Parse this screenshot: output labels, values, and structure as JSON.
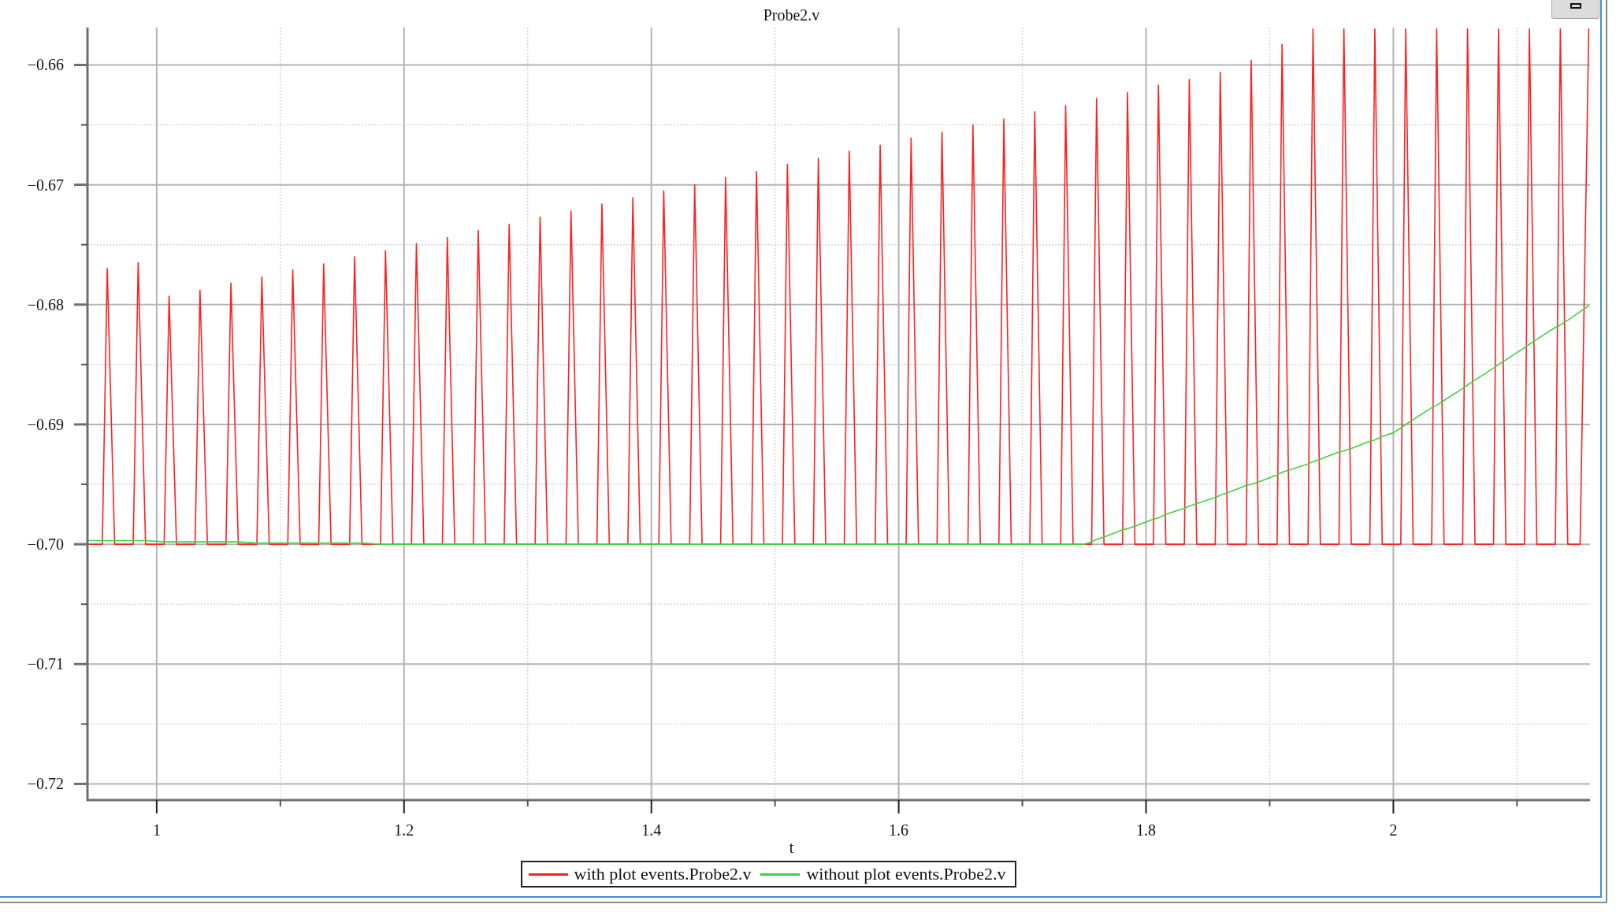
{
  "plot": {
    "chart_data": {
      "type": "line",
      "title": "Probe2.v",
      "xlabel": "t",
      "grid": true,
      "xlim": [
        0.944,
        2.159
      ],
      "ylim": [
        -0.72135,
        -0.65688
      ],
      "xticks": [
        {
          "value": 1,
          "label": "1"
        },
        {
          "value": 1.2,
          "label": "1.2"
        },
        {
          "value": 1.4,
          "label": "1.4"
        },
        {
          "value": 1.6,
          "label": "1.6"
        },
        {
          "value": 1.8,
          "label": "1.8"
        },
        {
          "value": 2,
          "label": "2"
        }
      ],
      "yticks": [
        {
          "value": -0.72,
          "label": "−0.72"
        },
        {
          "value": -0.71,
          "label": "−0.71"
        },
        {
          "value": -0.7,
          "label": "−0.70"
        },
        {
          "value": -0.69,
          "label": "−0.69"
        },
        {
          "value": -0.68,
          "label": "−0.68"
        },
        {
          "value": -0.67,
          "label": "−0.67"
        },
        {
          "value": -0.66,
          "label": "−0.66"
        }
      ],
      "x": [
        0.945,
        0.956,
        0.96,
        0.966,
        0.981,
        0.985,
        0.991,
        1.006,
        1.01,
        1.016,
        1.031,
        1.035,
        1.041,
        1.056,
        1.06,
        1.066,
        1.081,
        1.085,
        1.091,
        1.106,
        1.11,
        1.116,
        1.131,
        1.135,
        1.141,
        1.156,
        1.16,
        1.166,
        1.181,
        1.185,
        1.191,
        1.206,
        1.21,
        1.216,
        1.231,
        1.235,
        1.241,
        1.256,
        1.26,
        1.266,
        1.281,
        1.285,
        1.291,
        1.306,
        1.31,
        1.316,
        1.331,
        1.335,
        1.341,
        1.356,
        1.36,
        1.366,
        1.381,
        1.385,
        1.391,
        1.406,
        1.41,
        1.416,
        1.431,
        1.435,
        1.441,
        1.456,
        1.46,
        1.466,
        1.481,
        1.485,
        1.491,
        1.506,
        1.51,
        1.516,
        1.531,
        1.535,
        1.541,
        1.556,
        1.56,
        1.566,
        1.581,
        1.585,
        1.591,
        1.606,
        1.61,
        1.616,
        1.631,
        1.635,
        1.641,
        1.656,
        1.66,
        1.666,
        1.681,
        1.685,
        1.691,
        1.706,
        1.71,
        1.716,
        1.731,
        1.735,
        1.741,
        1.75,
        1.756,
        1.76,
        1.766,
        1.781,
        1.785,
        1.791,
        1.806,
        1.81,
        1.816,
        1.831,
        1.835,
        1.841,
        1.856,
        1.86,
        1.866,
        1.881,
        1.885,
        1.891,
        1.906,
        1.91,
        1.916,
        1.931,
        1.935,
        1.941,
        1.956,
        1.96,
        1.966,
        1.981,
        1.985,
        1.991,
        2.0,
        2.006,
        2.01,
        2.016,
        2.031,
        2.035,
        2.041,
        2.056,
        2.06,
        2.066,
        2.081,
        2.085,
        2.091,
        2.106,
        2.11,
        2.116,
        2.131,
        2.135,
        2.141,
        2.151,
        2.158
      ],
      "series": [
        {
          "name": "with plot events.Probe2.v",
          "color": "#ff2020",
          "values": [
            -0.7,
            -0.7,
            -0.677,
            -0.7,
            -0.7,
            -0.6765,
            -0.7,
            -0.7,
            -0.6793,
            -0.7,
            -0.7,
            -0.6788,
            -0.7,
            -0.7,
            -0.6782,
            -0.7,
            -0.7,
            -0.6777,
            -0.7,
            -0.7,
            -0.6771,
            -0.7,
            -0.7,
            -0.6766,
            -0.7,
            -0.7,
            -0.676,
            -0.7,
            -0.7,
            -0.6755,
            -0.7,
            -0.7,
            -0.6749,
            -0.7,
            -0.7,
            -0.6744,
            -0.7,
            -0.7,
            -0.6738,
            -0.7,
            -0.7,
            -0.6733,
            -0.7,
            -0.7,
            -0.6727,
            -0.7,
            -0.7,
            -0.6722,
            -0.7,
            -0.7,
            -0.6716,
            -0.7,
            -0.7,
            -0.6711,
            -0.7,
            -0.7,
            -0.6705,
            -0.7,
            -0.7,
            -0.67,
            -0.7,
            -0.7,
            -0.6694,
            -0.7,
            -0.7,
            -0.6689,
            -0.7,
            -0.7,
            -0.6683,
            -0.7,
            -0.7,
            -0.6678,
            -0.7,
            -0.7,
            -0.6672,
            -0.7,
            -0.7,
            -0.6667,
            -0.7,
            -0.7,
            -0.6661,
            -0.7,
            -0.7,
            -0.6656,
            -0.7,
            -0.7,
            -0.665,
            -0.7,
            -0.7,
            -0.6645,
            -0.7,
            -0.7,
            -0.6639,
            -0.7,
            -0.7,
            -0.6634,
            -0.7,
            -0.7,
            -0.7,
            -0.6628,
            -0.7,
            -0.7,
            -0.6623,
            -0.7,
            -0.7,
            -0.6617,
            -0.7,
            -0.7,
            -0.6612,
            -0.7,
            -0.7,
            -0.6606,
            -0.7,
            -0.7,
            -0.6596,
            -0.7,
            -0.7,
            -0.6583,
            -0.7,
            -0.7,
            -0.657,
            -0.7,
            -0.7,
            -0.657,
            -0.7,
            -0.7,
            -0.657,
            -0.7,
            -0.7,
            -0.7,
            -0.657,
            -0.7,
            -0.7,
            -0.657,
            -0.7,
            -0.7,
            -0.657,
            -0.7,
            -0.7,
            -0.657,
            -0.7,
            -0.7,
            -0.657,
            -0.7,
            -0.7,
            -0.657,
            -0.7,
            -0.7,
            -0.657
          ]
        },
        {
          "name": "without plot events.Probe2.v",
          "color": "#40d040",
          "values": [
            -0.6997,
            -0.6997,
            -0.6997,
            -0.6997,
            -0.6997,
            -0.6997,
            -0.6997,
            -0.6998,
            -0.6998,
            -0.6998,
            -0.6998,
            -0.6998,
            -0.6998,
            -0.6998,
            -0.6998,
            -0.6998,
            -0.6999,
            -0.6999,
            -0.6999,
            -0.6999,
            -0.6999,
            -0.6999,
            -0.6999,
            -0.6999,
            -0.6999,
            -0.6999,
            -0.6999,
            -0.6999,
            -0.7,
            -0.7,
            -0.7,
            -0.7,
            -0.7,
            -0.7,
            -0.7,
            -0.7,
            -0.7,
            -0.7,
            -0.7,
            -0.7,
            -0.7,
            -0.7,
            -0.7,
            -0.7,
            -0.7,
            -0.7,
            -0.7,
            -0.7,
            -0.7,
            -0.7,
            -0.7,
            -0.7,
            -0.7,
            -0.7,
            -0.7,
            -0.7,
            -0.7,
            -0.7,
            -0.7,
            -0.7,
            -0.7,
            -0.7,
            -0.7,
            -0.7,
            -0.7,
            -0.7,
            -0.7,
            -0.7,
            -0.7,
            -0.7,
            -0.7,
            -0.7,
            -0.7,
            -0.7,
            -0.7,
            -0.7,
            -0.7,
            -0.7,
            -0.7,
            -0.7,
            -0.7,
            -0.7,
            -0.7,
            -0.7,
            -0.7,
            -0.7,
            -0.7,
            -0.7,
            -0.7,
            -0.7,
            -0.7,
            -0.7,
            -0.7,
            -0.7,
            -0.7,
            -0.7,
            -0.7,
            -0.7,
            -0.6998,
            -0.6996,
            -0.6994,
            -0.6988,
            -0.6987,
            -0.6985,
            -0.6979,
            -0.6978,
            -0.6975,
            -0.697,
            -0.6968,
            -0.6966,
            -0.6961,
            -0.6959,
            -0.6957,
            -0.6951,
            -0.695,
            -0.6948,
            -0.6942,
            -0.694,
            -0.6938,
            -0.6933,
            -0.6931,
            -0.6929,
            -0.6923,
            -0.6922,
            -0.692,
            -0.6914,
            -0.6913,
            -0.691,
            -0.6907,
            -0.6903,
            -0.69,
            -0.6896,
            -0.6886,
            -0.6884,
            -0.688,
            -0.687,
            -0.6867,
            -0.6863,
            -0.6853,
            -0.685,
            -0.6846,
            -0.6836,
            -0.6833,
            -0.6829,
            -0.6819,
            -0.6817,
            -0.6813,
            -0.6806,
            -0.6801
          ]
        }
      ]
    }
  }
}
